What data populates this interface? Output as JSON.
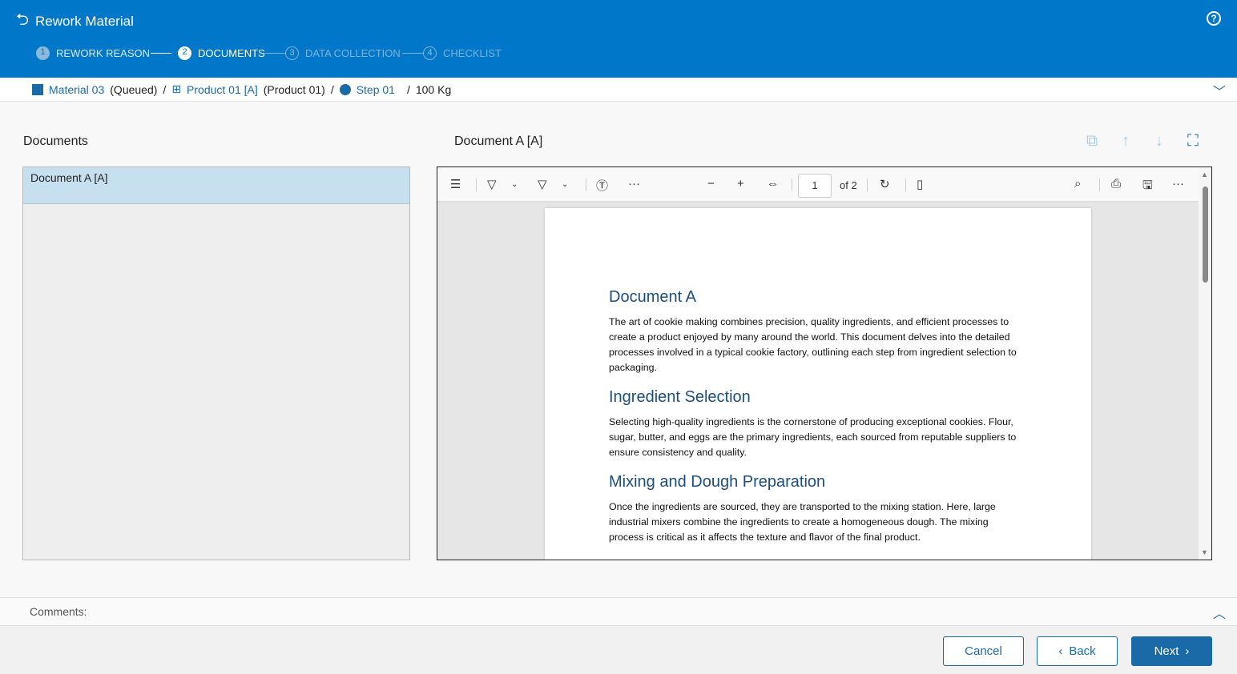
{
  "header": {
    "title": "Rework Material",
    "steps": [
      {
        "num": "1",
        "label": "REWORK REASON"
      },
      {
        "num": "2",
        "label": "DOCUMENTS"
      },
      {
        "num": "3",
        "label": "DATA COLLECTION"
      },
      {
        "num": "4",
        "label": "CHECKLIST"
      }
    ]
  },
  "breadcrumb": {
    "material": "Material 03",
    "material_state": "(Queued)",
    "product": "Product 01 [A]",
    "product_name": "(Product 01)",
    "step": "Step 01",
    "quantity": "100 Kg",
    "sep": "/"
  },
  "documents": {
    "heading": "Documents",
    "items": [
      "Document A [A]"
    ]
  },
  "viewer": {
    "title": "Document A [A]",
    "page": "1",
    "of": "of 2",
    "content": [
      {
        "heading": "Document A",
        "text": "The art of cookie making combines precision, quality ingredients, and efficient processes to create a product enjoyed by many around the world. This document delves into the detailed processes involved in a typical cookie factory, outlining each step from ingredient selection to packaging."
      },
      {
        "heading": "Ingredient Selection",
        "text": "Selecting high-quality ingredients is the cornerstone of producing exceptional cookies. Flour, sugar, butter, and eggs are the primary ingredients, each sourced from reputable suppliers to ensure consistency and quality."
      },
      {
        "heading": "Mixing and Dough Preparation",
        "text": "Once the ingredients are sourced, they are transported to the mixing station. Here, large industrial mixers combine the ingredients to create a homogeneous dough. The mixing process is critical as it affects the texture and flavor of the final product."
      }
    ]
  },
  "comments": {
    "label": "Comments:"
  },
  "footer": {
    "cancel": "Cancel",
    "back": "Back",
    "next": "Next"
  },
  "colors": {
    "brand": "#0077c8",
    "accent": "#1a6aa8"
  }
}
